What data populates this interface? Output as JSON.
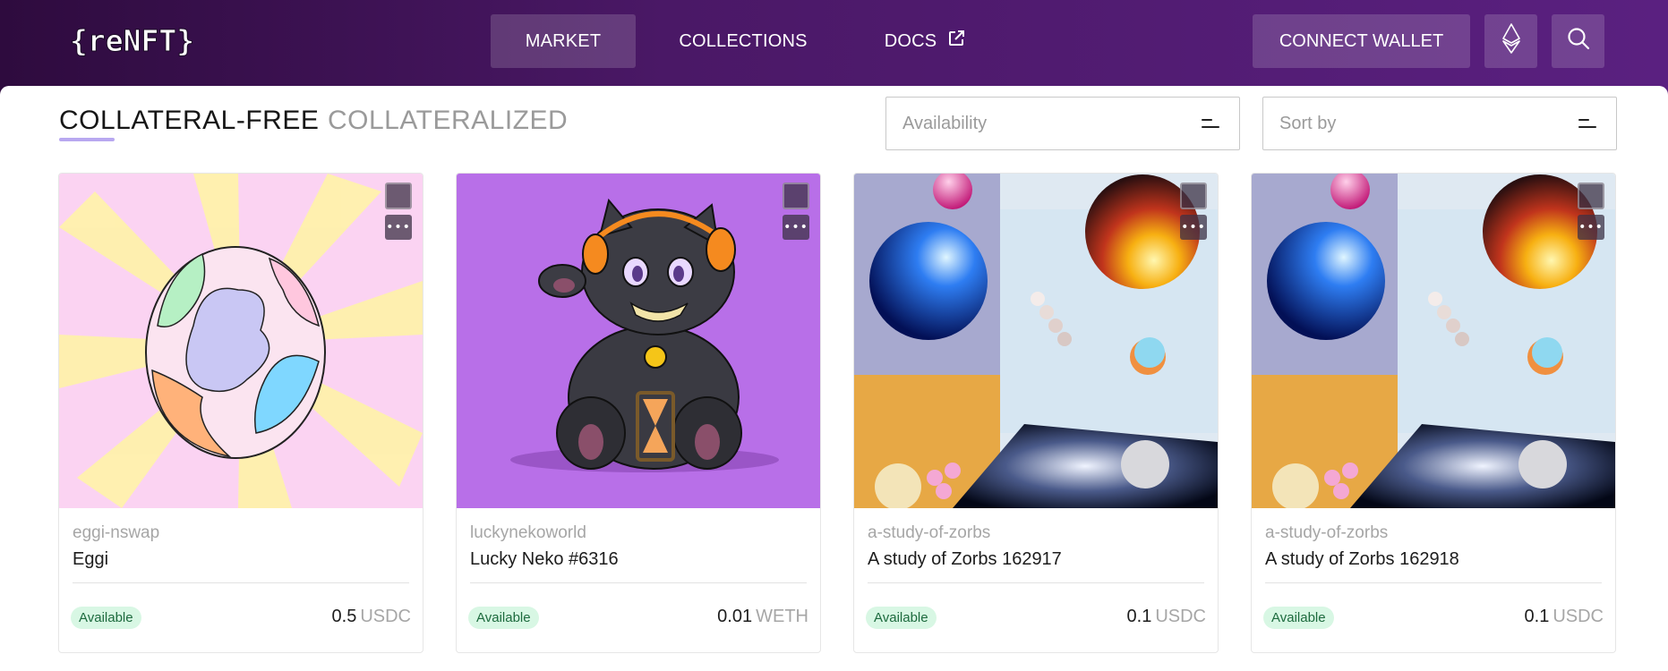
{
  "header": {
    "logo_text": "{reNFT}",
    "nav": [
      {
        "label": "MARKET"
      },
      {
        "label": "COLLECTIONS"
      },
      {
        "label": "DOCS"
      }
    ],
    "connect_wallet": "CONNECT WALLET",
    "network_icon": "ethereum-icon",
    "search_icon": "search-icon"
  },
  "tabs": {
    "collateral_free": "COLLATERAL-FREE",
    "collateralized": "COLLATERALIZED"
  },
  "filters": {
    "availability_placeholder": "Availability",
    "sort_placeholder": "Sort by"
  },
  "cards": [
    {
      "collection": "eggi-nswap",
      "name": "Eggi",
      "status": "Available",
      "price": "0.5",
      "currency": "USDC"
    },
    {
      "collection": "luckynekoworld",
      "name": "Lucky Neko #6316",
      "status": "Available",
      "price": "0.01",
      "currency": "WETH"
    },
    {
      "collection": "a-study-of-zorbs",
      "name": "A study of Zorbs 162917",
      "status": "Available",
      "price": "0.1",
      "currency": "USDC"
    },
    {
      "collection": "a-study-of-zorbs",
      "name": "A study of Zorbs 162918",
      "status": "Available",
      "price": "0.1",
      "currency": "USDC"
    }
  ],
  "colors": {
    "header_start": "#2e0b3e",
    "header_end": "#5a2080",
    "badge_bg": "#d8f7e4",
    "tab_underline": "#b8a8f0"
  }
}
